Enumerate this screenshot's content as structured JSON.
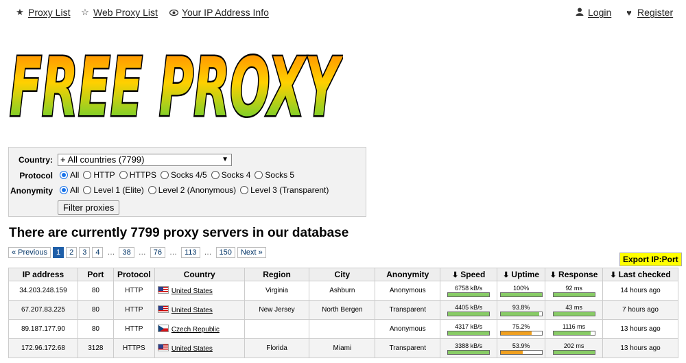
{
  "nav": {
    "proxy_list": "Proxy List",
    "web_proxy_list": "Web Proxy List",
    "ip_info": "Your IP Address Info",
    "login": "Login",
    "register": "Register"
  },
  "logo_text": "FREE PROXY",
  "filter": {
    "country_label": "Country:",
    "country_value": "+ All countries (7799)",
    "protocol_label": "Protocol",
    "protocol_options": [
      "All",
      "HTTP",
      "HTTPS",
      "Socks 4/5",
      "Socks 4",
      "Socks 5"
    ],
    "protocol_selected": "All",
    "anonymity_label": "Anonymity",
    "anonymity_options": [
      "All",
      "Level 1 (Elite)",
      "Level 2 (Anonymous)",
      "Level 3 (Transparent)"
    ],
    "anonymity_selected": "All",
    "button_label": "Filter proxies"
  },
  "heading": "There are currently 7799 proxy servers in our database",
  "pagination": {
    "previous": "« Previous",
    "next": "Next »",
    "pages": [
      "1",
      "2",
      "3",
      "4",
      "…",
      "38",
      "…",
      "76",
      "…",
      "113",
      "…",
      "150"
    ],
    "current": "1"
  },
  "export_label": "Export IP:Port",
  "table": {
    "headers": [
      "IP address",
      "Port",
      "Protocol",
      "Country",
      "Region",
      "City",
      "Anonymity",
      "Speed",
      "Uptime",
      "Response",
      "Last checked"
    ],
    "rows": [
      {
        "ip": "34.203.248.159",
        "port": "80",
        "protocol": "HTTP",
        "country": "United States",
        "flag": "us",
        "region": "Virginia",
        "city": "Ashburn",
        "anonymity": "Anonymous",
        "speed": "6758 kB/s",
        "speed_level": 1.0,
        "uptime": "100%",
        "uptime_level": 1.0,
        "response": "92 ms",
        "response_level": 1.0,
        "last_checked": "14 hours ago"
      },
      {
        "ip": "67.207.83.225",
        "port": "80",
        "protocol": "HTTP",
        "country": "United States",
        "flag": "us",
        "region": "New Jersey",
        "city": "North Bergen",
        "anonymity": "Transparent",
        "speed": "4405 kB/s",
        "speed_level": 1.0,
        "uptime": "93.8%",
        "uptime_level": 0.938,
        "response": "43 ms",
        "response_level": 1.0,
        "last_checked": "7 hours ago"
      },
      {
        "ip": "89.187.177.90",
        "port": "80",
        "protocol": "HTTP",
        "country": "Czech Republic",
        "flag": "cz",
        "region": "",
        "city": "",
        "anonymity": "Anonymous",
        "speed": "4317 kB/s",
        "speed_level": 1.0,
        "uptime": "75.2%",
        "uptime_level": 0.752,
        "response": "1116 ms",
        "response_level": 0.9,
        "last_checked": "13 hours ago"
      },
      {
        "ip": "172.96.172.68",
        "port": "3128",
        "protocol": "HTTPS",
        "country": "United States",
        "flag": "us",
        "region": "Florida",
        "city": "Miami",
        "anonymity": "Transparent",
        "speed": "3388 kB/s",
        "speed_level": 1.0,
        "uptime": "53.9%",
        "uptime_level": 0.539,
        "response": "202 ms",
        "response_level": 1.0,
        "last_checked": "13 hours ago"
      }
    ]
  },
  "colors": {
    "bar_green": "#88cc66",
    "bar_orange": "#f0a020",
    "page_current": "#1f5fa8",
    "export_bg": "#ffff00"
  },
  "icons": {
    "proxy_list": "star-icon",
    "web_proxy_list": "star-outline-icon",
    "ip_info": "eye-icon",
    "login": "user-icon",
    "register": "heart-icon",
    "sort": "arrow-down-icon"
  }
}
